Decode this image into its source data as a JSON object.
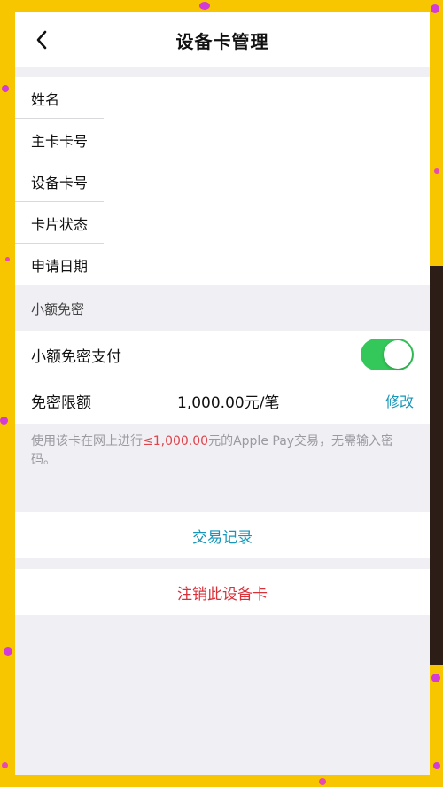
{
  "header": {
    "title": "设备卡管理"
  },
  "info_rows": [
    {
      "label": "姓名"
    },
    {
      "label": "主卡卡号"
    },
    {
      "label": "设备卡号"
    },
    {
      "label": "卡片状态"
    },
    {
      "label": "申请日期"
    }
  ],
  "section": {
    "title": "小额免密"
  },
  "settings": {
    "toggle_label": "小额免密支付",
    "toggle_on": true,
    "limit_label": "免密限额",
    "limit_value": "1,000.00元/笔",
    "edit_label": "修改"
  },
  "note": {
    "prefix": "使用该卡在网上进行",
    "amount": "≤1,000.00",
    "suffix": "元的Apple Pay交易，无需输入密码。"
  },
  "actions": {
    "transactions": "交易记录",
    "cancel_card": "注销此设备卡"
  },
  "colors": {
    "frame": "#f7c600",
    "toggle_on": "#34c759",
    "link_blue": "#1696b9",
    "danger_red": "#d9313a"
  }
}
